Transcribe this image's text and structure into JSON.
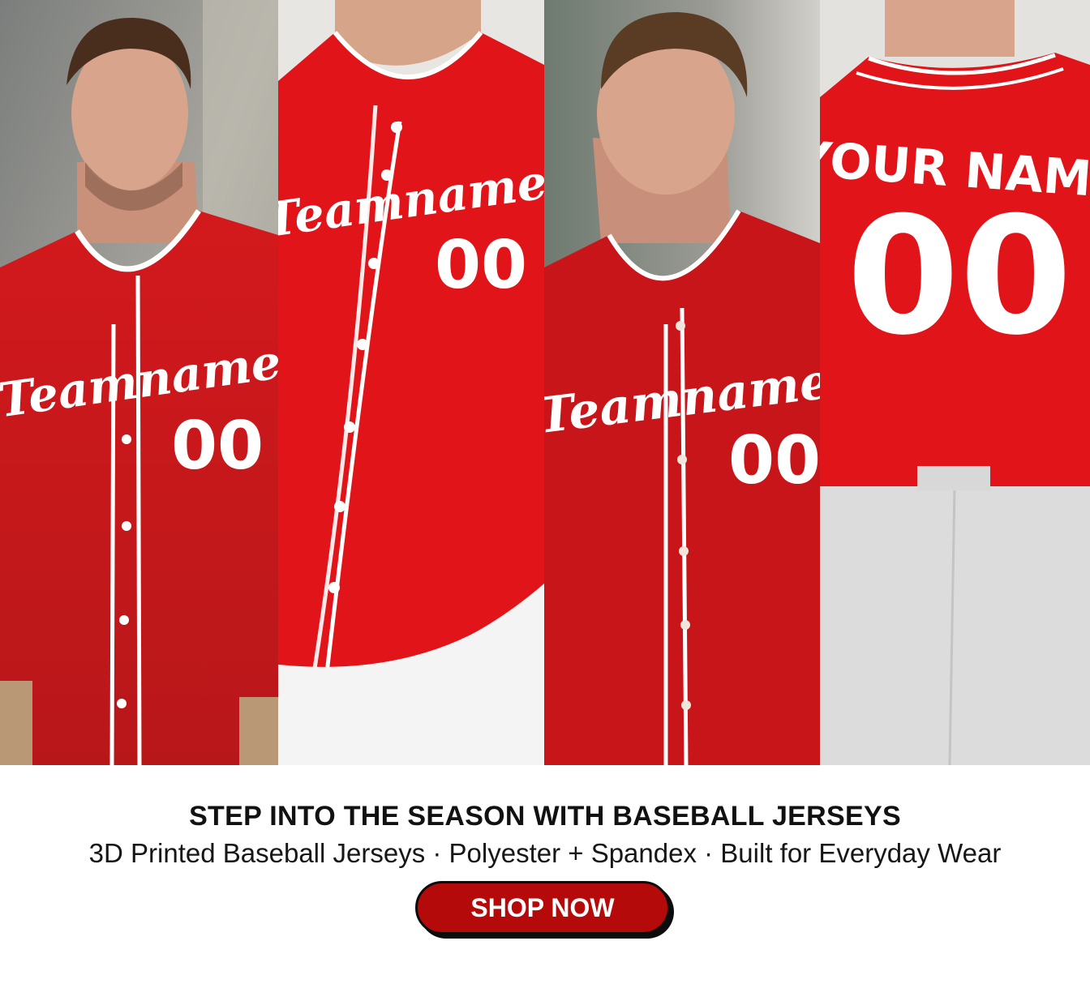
{
  "gallery": {
    "panels": [
      {
        "jersey_script": "Teamname",
        "jersey_number": "00",
        "view": "front"
      },
      {
        "jersey_script": "Teamname",
        "jersey_number": "00",
        "view": "front-closeup"
      },
      {
        "jersey_script": "Teamname",
        "jersey_number": "00",
        "view": "front"
      },
      {
        "jersey_name": "YOUR NAME",
        "jersey_number": "00",
        "view": "back"
      }
    ]
  },
  "banner": {
    "headline": "STEP INTO THE SEASON WITH BASEBALL JERSEYS",
    "subline": "3D Printed Baseball Jerseys · Polyester + Spandex · Built for Everyday Wear",
    "cta_label": "SHOP NOW"
  },
  "colors": {
    "jersey_red": "#d8141a",
    "piping_white": "#ffffff",
    "cta_red": "#b50a0a"
  }
}
